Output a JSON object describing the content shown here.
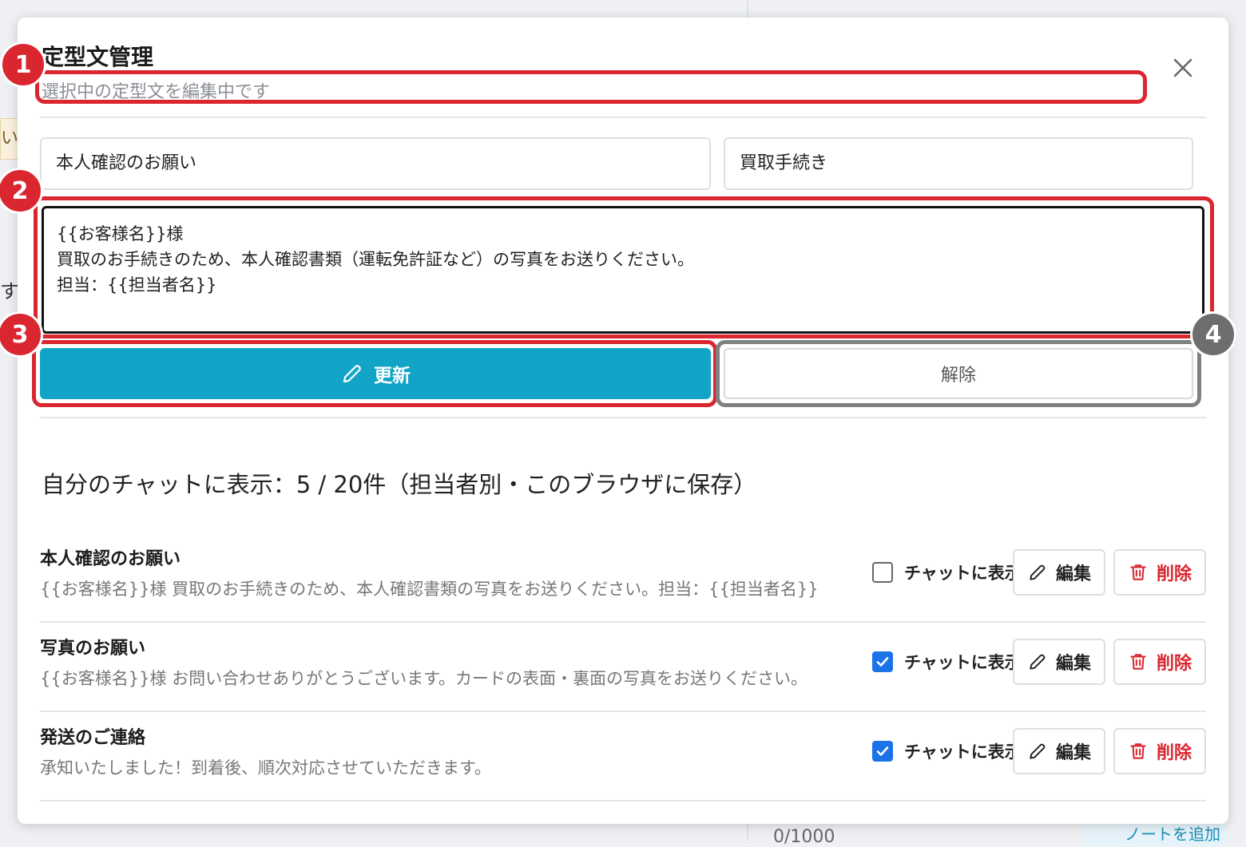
{
  "background": {
    "left_note_text": "い。",
    "left_fragment": "す",
    "char_counter": "0/1000",
    "add_note_label": "ノートを追加"
  },
  "modal": {
    "title": "定型文管理",
    "subtitle": "選択中の定型文を編集中です",
    "close_icon": "close-icon"
  },
  "form": {
    "title_value": "本人確認のお願い",
    "category_value": "買取手続き",
    "body_lines": [
      "{{お客様名}}様",
      "買取のお手続きのため、本人確認書類（運転免許証など）の写真をお送りください。",
      "担当：{{担当者名}}"
    ],
    "update_label": "更新",
    "release_label": "解除"
  },
  "section": {
    "heading": "自分のチャットに表示：5 / 20件（担当者別・このブラウザに保存）"
  },
  "templates": [
    {
      "title": "本人確認のお願い",
      "body": "{{お客様名}}様 買取のお手続きのため、本人確認書類の写真をお送りください。担当：{{担当者名}}",
      "show_in_chat": false,
      "show_label": "チャットに表示",
      "edit_label": "編集",
      "delete_label": "削除"
    },
    {
      "title": "写真のお願い",
      "body": "{{お客様名}}様 お問い合わせありがとうございます。カードの表面・裏面の写真をお送りください。",
      "show_in_chat": true,
      "show_label": "チャットに表示",
      "edit_label": "編集",
      "delete_label": "削除"
    },
    {
      "title": "発送のご連絡",
      "body": "承知いたしました！到着後、順次対応させていただきます。",
      "show_in_chat": true,
      "show_label": "チャットに表示",
      "edit_label": "編集",
      "delete_label": "削除"
    }
  ],
  "annotations": [
    "1",
    "2",
    "3",
    "4"
  ],
  "colors": {
    "accent": "#12a4c6",
    "annotation_red": "#d9262f",
    "annotation_grey": "#6e6e6e",
    "delete_red": "#d9262f",
    "checkbox_blue": "#1a73e8"
  }
}
